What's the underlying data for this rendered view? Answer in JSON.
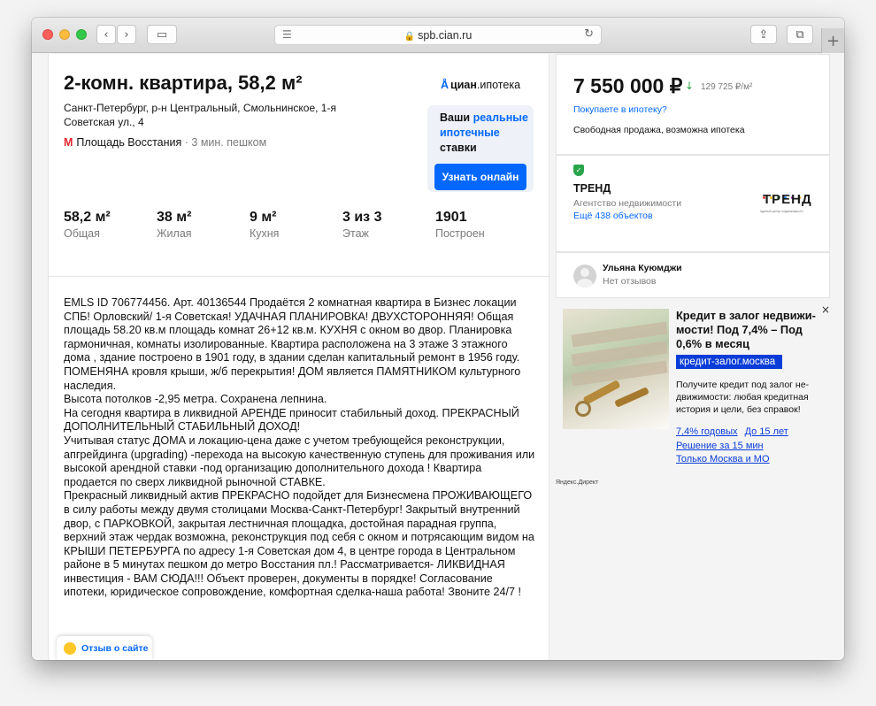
{
  "browser": {
    "url": "spb.cian.ru",
    "reader_icon": "☰",
    "reload_icon": "↻",
    "lock_icon": "🔒",
    "back_icon": "‹",
    "forward_icon": "›",
    "sidebar_icon": "▭",
    "share_icon": "⇪",
    "tabs_icon": "⧉",
    "new_tab_icon": "+"
  },
  "listing": {
    "title": "2-комн. квартира, 58,2 м²",
    "address": "Санкт-Петербург, р-н Центральный, Смольнинское, 1-я Советская ул., 4",
    "metro_icon": "М",
    "metro_station": "Площадь Восстания",
    "metro_distance": " · 3 мин. пешком",
    "facts": [
      {
        "value": "58,2 м²",
        "label": "Общая"
      },
      {
        "value": "38 м²",
        "label": "Жилая"
      },
      {
        "value": "9 м²",
        "label": "Кухня"
      },
      {
        "value": "3 из 3",
        "label": "Этаж"
      },
      {
        "value": "1901",
        "label": "Построен"
      }
    ],
    "description": "EMLS ID 706774456. Арт. 40136544 Продаётся 2 комнатная квартира в Бизнес локации СПБ! Орловский/ 1-я Советская! УДАЧНАЯ ПЛАНИРОВКА! ДВУХСТОРОННЯЯ! Общая площадь 58.20 кв.м площадь комнат 26+12 кв.м. КУХНЯ с окном во двор. Планировка гармоничная, комнаты изолированные.  Квартира расположена на 3 этаже 3 этажного дома , здание построено в 1901 году, в здании сделан капитальный ремонт в 1956 году. ПОМЕНЯНА кровля крыши, ж/б перекрытия! ДОМ является ПАМЯТНИКОМ культурного наследия.\nВысота потолков -2,95 метра. Сохранена лепнина.\nНа сегодня квартира в ликвидной АРЕНДЕ приносит стабильный доход. ПРЕКРАСНЫЙ ДОПОЛНИТЕЛЬНЫЙ СТАБИЛЬНЫЙ ДОХОД!\n Учитывая статус ДОМА и локацию-цена даже с учетом требующейся реконструкции, апгрейдинга (upgrading) -перехода на высокую качественную ступень для проживания или высокой арендной ставки -под организацию дополнительного дохода ! Квартира продается по сверх ликвидной рыночной СТАВКЕ.\nПрекрасный ликвидный актив ПРЕКРАСНО подойдет для Бизнесмена ПРОЖИВАЮЩЕГО в силу работы между двумя столицами Москва-Санкт-Петербург! Закрытый внутренний двор, с ПАРКОВКОЙ, закрытая лестничная площадка, достойная парадная группа, верхний этаж чердак возможна, реконструкция под себя с окном и потрясающим видом на КРЫШИ ПЕТЕРБУРГА по адресу 1-я Советская дом 4, в центре города в Центральном районе в 5 минутах пешком до метро Восстания пл.!  Рассматривается- ЛИКВИДНАЯ инвестиция - ВАМ СЮДА!!! Объект проверен, документы в порядке! Согласование ипотеки, юридическое сопровождение, комфортная сделка-наша работа! Звоните 24/7 !",
    "feedback_label": "Отзыв о сайте"
  },
  "mortgage": {
    "logo_brand": "циан",
    "logo_suffix": ".ипотека",
    "logo_icon": "Å",
    "text_prefix": "Ваши ",
    "text_highlight": "реальные ипотечные",
    "text_suffix": " ставки",
    "button": "Узнать онлайн"
  },
  "price": {
    "value": "7 550 000 ₽",
    "trend_icon": "↓",
    "per_meter": "129 725 ₽/м²",
    "mortgage_link": "Покупаете в ипотеку?",
    "sale_type": "Свободная продажа, возможна ипотека"
  },
  "agency": {
    "name": "ТРЕНД",
    "type": "Агентство недвижимости",
    "objects_link": "Ещё 438 объектов",
    "logo_text": "ТРЕНД",
    "logo_subtext": "единый центр недвижимости",
    "verified_icon": "✓",
    "dot_colors": [
      "#e53935",
      "#fbc02d",
      "#43a047",
      "#1e88e5",
      "#8e24aa",
      "#fb8c00"
    ]
  },
  "agent": {
    "name": "Ульяна Куюмджи",
    "reviews": "Нет отзывов"
  },
  "ad": {
    "title": "Кредит в залог недвижи-мости! Под 7,4% – Под 0,6% в месяц",
    "domain": "кредит-залог.москва",
    "text": "Получите кредит под залог не-движимости: любая кредитная история и цели, без справок!",
    "links": [
      "7,4% годовых",
      "До 15 лет",
      "Решение за 15 мин",
      "Только Москва и МО"
    ],
    "close_icon": "×",
    "source": "Яндекс.Директ"
  },
  "colors": {
    "accent": "#0468ff",
    "metro": "#e3252b",
    "price_down": "#2aa44a",
    "ad_link": "#0a3dd8"
  }
}
